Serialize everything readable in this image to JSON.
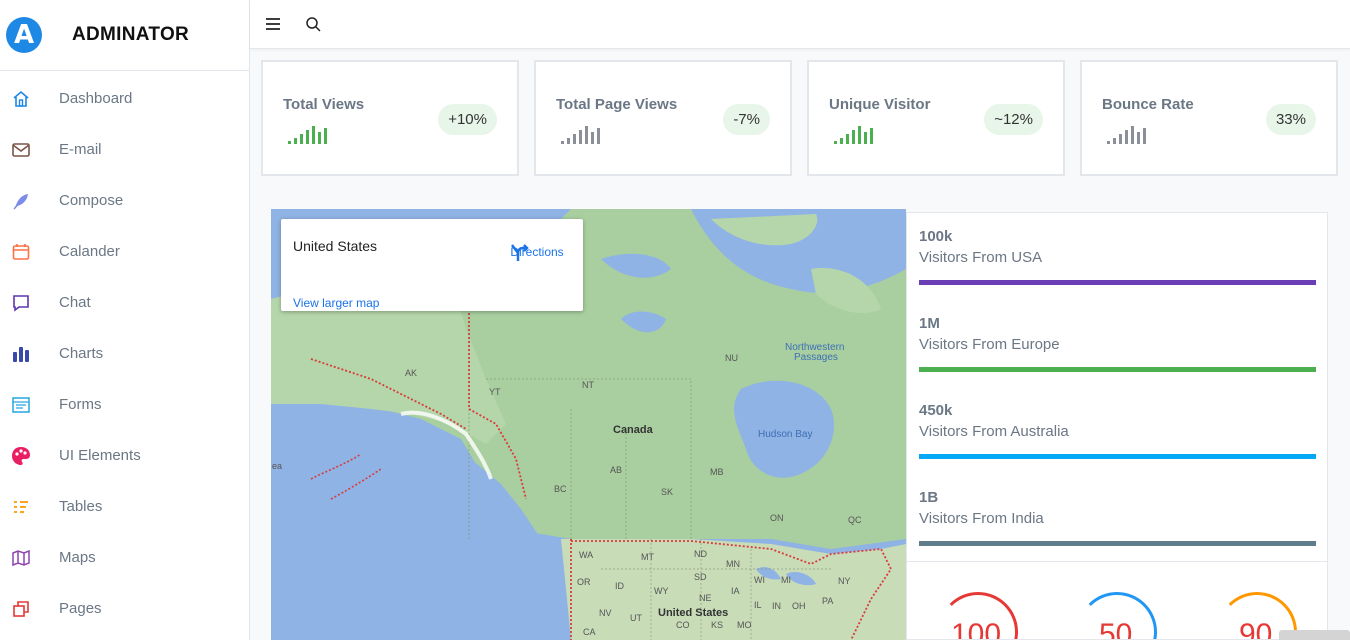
{
  "brand": {
    "logo_letter": "A",
    "name": "ADMINATOR"
  },
  "sidebar": {
    "items": [
      {
        "label": "Dashboard",
        "icon": "home-icon",
        "color": "#1e88e5"
      },
      {
        "label": "E-mail",
        "icon": "mail-icon",
        "color": "#795548"
      },
      {
        "label": "Compose",
        "icon": "feather-icon",
        "color": "#7c8ce8"
      },
      {
        "label": "Calander",
        "icon": "calendar-icon",
        "color": "#ff7043"
      },
      {
        "label": "Chat",
        "icon": "chat-icon",
        "color": "#5e35b1"
      },
      {
        "label": "Charts",
        "icon": "bar-chart-icon",
        "color": "#3949ab"
      },
      {
        "label": "Forms",
        "icon": "form-icon",
        "color": "#26a6e0"
      },
      {
        "label": "UI Elements",
        "icon": "palette-icon",
        "color": "#e91e63"
      },
      {
        "label": "Tables",
        "icon": "list-icon",
        "color": "#ff9800"
      },
      {
        "label": "Maps",
        "icon": "map-icon",
        "color": "#8e44ad"
      },
      {
        "label": "Pages",
        "icon": "copy-icon",
        "color": "#e53935"
      }
    ]
  },
  "topbar": {
    "menu_icon": "hamburger-icon",
    "search_icon": "search-icon"
  },
  "stats": [
    {
      "title": "Total Views",
      "badge": "+10%",
      "spark_color": "#4caf50"
    },
    {
      "title": "Total Page Views",
      "badge": "-7%",
      "spark_color": "#8a8f99"
    },
    {
      "title": "Unique Visitor",
      "badge": "~12%",
      "spark_color": "#4caf50"
    },
    {
      "title": "Bounce Rate",
      "badge": "33%",
      "spark_color": "#8a8f99"
    }
  ],
  "map": {
    "info": {
      "country": "United States",
      "directions": "Directions",
      "larger": "View larger map"
    },
    "labels": {
      "canada": "Canada",
      "united_states": "United States",
      "hudson_bay": "Hudson Bay",
      "northwestern_1": "Northwestern",
      "northwestern_2": "Passages",
      "ak": "AK",
      "yt": "YT",
      "nt": "NT",
      "nu": "NU",
      "bc": "BC",
      "ab": "AB",
      "sk": "SK",
      "mb": "MB",
      "on": "ON",
      "qc": "QC",
      "wa": "WA",
      "mt": "MT",
      "nd": "ND",
      "mn": "MN",
      "or": "OR",
      "id": "ID",
      "sd": "SD",
      "wy": "WY",
      "ne": "NE",
      "nv": "NV",
      "ut": "UT",
      "co": "CO",
      "ca": "CA",
      "ks": "KS",
      "mo": "MO",
      "ia": "IA",
      "il": "IL",
      "in": "IN",
      "oh": "OH",
      "pa": "PA",
      "mi": "MI",
      "wi": "WI",
      "ny": "NY",
      "ea": "ea"
    }
  },
  "visitors": [
    {
      "value": "100k",
      "label": "Visitors From USA",
      "color": "#6a3fb5"
    },
    {
      "value": "1M",
      "label": "Visitors From Europe",
      "color": "#4caf50"
    },
    {
      "value": "450k",
      "label": "Visitors From Australia",
      "color": "#03a9f4"
    },
    {
      "value": "1B",
      "label": "Visitors From India",
      "color": "#607d8b"
    }
  ],
  "gauges": [
    {
      "value": "100",
      "color": "#e53935"
    },
    {
      "value": "50",
      "color": "#2196f3"
    },
    {
      "value": "90",
      "color": "#ff9800"
    }
  ]
}
